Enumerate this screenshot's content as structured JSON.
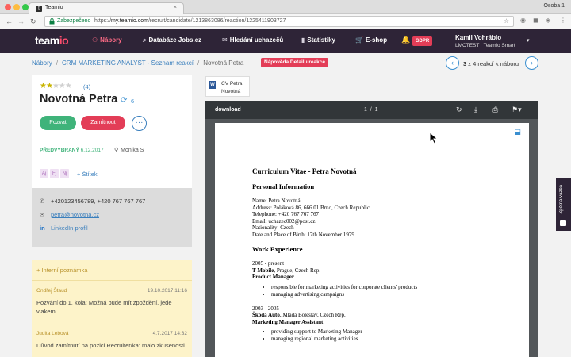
{
  "browser": {
    "tab_title": "Teamio",
    "tab_favicon": "t",
    "tab_close": "×",
    "profile": "Osoba 1",
    "secure_label": "Zabezpečeno",
    "url_scheme": "https://",
    "url_host": "my.teamio.com",
    "url_path": "/recruit/candidate/1213863086/reaction/1225411903727",
    "back": "←",
    "forward": "→",
    "reload": "↻",
    "bookmark_star": "☆"
  },
  "nav": {
    "logo_main": "team",
    "logo_accent": "io",
    "items": [
      {
        "icon": "people-icon",
        "glyph": "⚇",
        "label": "Nábory"
      },
      {
        "icon": "search-icon",
        "glyph": "⌕",
        "label": "Databáze Jobs.cz"
      },
      {
        "icon": "chat-icon",
        "glyph": "✉",
        "label": "Hledání uchazečů"
      },
      {
        "icon": "stats-icon",
        "glyph": "▮",
        "label": "Statistiky"
      },
      {
        "icon": "cart-icon",
        "glyph": "🛒",
        "label": "E-shop"
      }
    ],
    "bell": "🔔",
    "gdpr": "GDPR",
    "user_name": "Kamil Vohráblo",
    "user_company": "LMCTEST_ Teamio Smart",
    "caret": "▾"
  },
  "breadcrumb": {
    "root": "Nábory",
    "job": "CRM MARKETING ANALYST - Seznam reakcí",
    "current": "Novotná Petra",
    "sep": "/",
    "help": "Nápověda Detailu reakce"
  },
  "pager": {
    "prev": "‹",
    "next": "›",
    "current": "3",
    "text": " z 4 reakcí k náboru"
  },
  "candidate": {
    "rating": 2,
    "rating_max": 5,
    "rating_count": "(4)",
    "name": "Novotná Petra",
    "sync_count": "6",
    "btn_invite": "Pozvat",
    "btn_reject": "Zamítnout",
    "btn_more": "···",
    "status": "PŘEDVYBRANÝ",
    "status_date": "6.12.2017",
    "owner": "Monika S",
    "tags": [
      "Aj",
      "Fj",
      "Nj"
    ],
    "add_tag": "+ Štítek"
  },
  "contact": {
    "phone": "+420123456789, +420 767 767 767",
    "email": "petra@novotna.cz",
    "linkedin": "LinkedIn profil"
  },
  "notes": {
    "header": "+ Interní poznámka",
    "items": [
      {
        "author": "Ondřej Štaud",
        "date": "19.10.2017 11:16",
        "text": "Pozvání do 1. kola: Možná bude mít zpoždění, jede vlakem."
      },
      {
        "author": "Judita Lebová",
        "date": "4.7.2017 14:32",
        "text": "Důvod zamítnutí na pozici Recruiter/ka: malo zkusenosti"
      }
    ]
  },
  "file": {
    "icon": "W",
    "name_line1": "CV Petra",
    "name_line2": "Novotná"
  },
  "viewer": {
    "title": "download",
    "page_current": "1",
    "page_sep": "/",
    "page_total": "1"
  },
  "cv": {
    "title": "Curriculum Vitae - Petra Novotná",
    "personal_heading": "Personal Information",
    "personal": [
      "Name: Petra Novotná",
      "Address: Poláková 86, 666 01 Brno, Czech Republic",
      "Telephone: +420 767 767 767",
      "Email: uchazec002@post.cz",
      "Nationality: Czech",
      "Date and Place of Birth: 17th November 1979"
    ],
    "work_heading": "Work Experience",
    "jobs": [
      {
        "period": "2005 - present",
        "company": "T-Mobile",
        "location": ", Prague, Czech Rep.",
        "position": "Product Manager",
        "duties": [
          "responsible for marketing activities for corporate clients' products",
          "managing advertising campaigns"
        ]
      },
      {
        "period": "2003 - 2005",
        "company": "Škoda Auto",
        "location": ", Mladá Boleslav, Czech Rep.",
        "position": "Marketing Manager Assistant",
        "duties": [
          "providing support to Marketing Manager",
          "managing regional marketing activities"
        ]
      }
    ]
  },
  "side_tab": "Zpětná vazba",
  "colors": {
    "nav_bg": "#2e2437",
    "accent_red": "#e33d57",
    "accent_green": "#3fb37a",
    "link_blue": "#3a7fbd",
    "notes_bg": "#fdf3c9"
  }
}
